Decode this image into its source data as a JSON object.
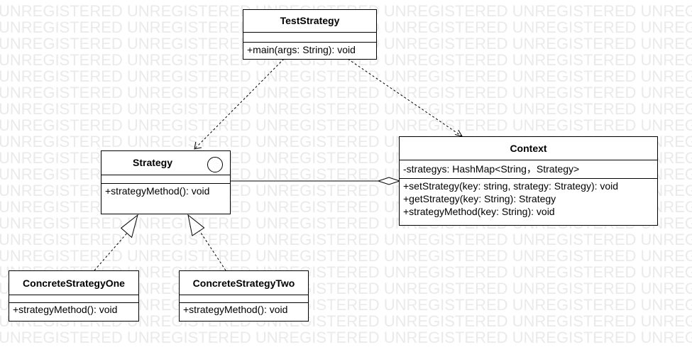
{
  "watermark": {
    "text": "UNREGISTERED UNREGISTERED UNREGISTERED UNREGISTERED UNREGISTERED UNREGISTERED"
  },
  "classes": {
    "test_strategy": {
      "name": "TestStrategy",
      "attributes": [],
      "operations": [
        "+main(args: String): void"
      ]
    },
    "strategy": {
      "name": "Strategy",
      "icon": "interface-circle-icon",
      "attributes": [],
      "operations": [
        "+strategyMethod(): void"
      ]
    },
    "context": {
      "name": "Context",
      "attributes": [
        "-strategys: HashMap<String，Strategy>"
      ],
      "operations": [
        "+setStrategy(key: string, strategy: Strategy): void",
        "+getStrategy(key: String): Strategy",
        "+strategyMethod(key: String): void"
      ]
    },
    "concrete_one": {
      "name": "ConcreteStrategyOne",
      "attributes": [],
      "operations": [
        "+strategyMethod(): void"
      ]
    },
    "concrete_two": {
      "name": "ConcreteStrategyTwo",
      "attributes": [],
      "operations": [
        "+strategyMethod(): void"
      ]
    }
  },
  "relationships": [
    {
      "type": "dependency",
      "from": "TestStrategy",
      "to": "Strategy"
    },
    {
      "type": "dependency",
      "from": "TestStrategy",
      "to": "Context"
    },
    {
      "type": "aggregation",
      "whole": "Context",
      "part": "Strategy"
    },
    {
      "type": "realization",
      "from": "ConcreteStrategyOne",
      "to": "Strategy"
    },
    {
      "type": "realization",
      "from": "ConcreteStrategyTwo",
      "to": "Strategy"
    }
  ]
}
